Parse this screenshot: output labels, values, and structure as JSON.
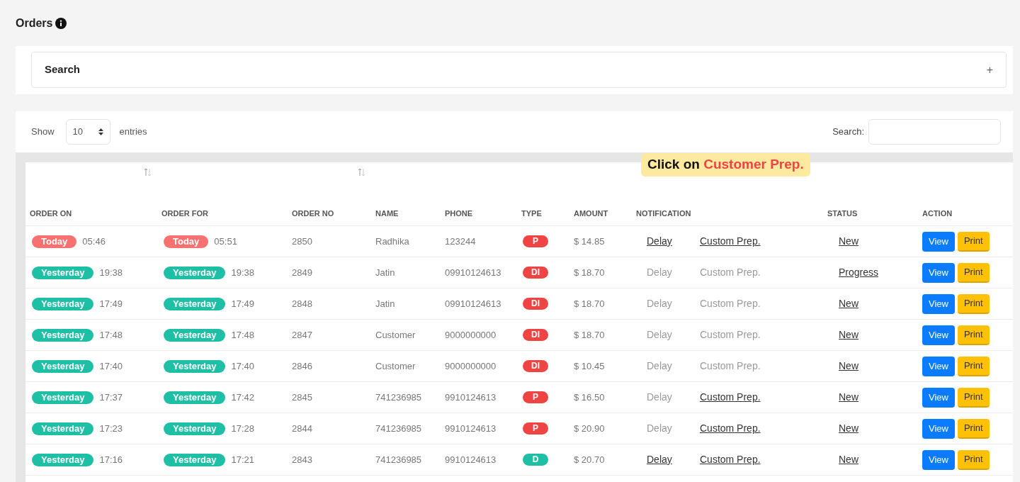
{
  "page": {
    "title": "Orders"
  },
  "search_panel": {
    "title": "Search",
    "toggle": "+"
  },
  "table_controls": {
    "show_label": "Show",
    "page_size": "10",
    "entries_label": "entries",
    "search_label": "Search:"
  },
  "callout": {
    "text": "Click on",
    "highlight": "Customer Prep."
  },
  "table": {
    "columns": [
      {
        "label": "ORDER ON",
        "sortable": true
      },
      {
        "label": "ORDER FOR",
        "sortable": false
      },
      {
        "label": "ORDER NO",
        "sortable": true
      },
      {
        "label": "NAME",
        "sortable": false
      },
      {
        "label": "PHONE",
        "sortable": false
      },
      {
        "label": "TYPE",
        "sortable": false
      },
      {
        "label": "AMOUNT",
        "sortable": false
      },
      {
        "label": "NOTIFICATION",
        "sortable": false
      },
      {
        "label": "STATUS",
        "sortable": false
      },
      {
        "label": "ACTION",
        "sortable": false
      }
    ],
    "rows": [
      {
        "order_on": {
          "day": "Today",
          "kind": "today",
          "time": "05:46"
        },
        "order_for": {
          "day": "Today",
          "kind": "today",
          "time": "05:51"
        },
        "order_no": "2850",
        "name": "Radhika",
        "phone": "123244",
        "type": {
          "label": "P",
          "color": "#ef4444"
        },
        "amount": "$ 14.85",
        "delay": {
          "label": "Delay",
          "disabled": false
        },
        "custom_prep": {
          "label": "Custom Prep.",
          "disabled": false
        },
        "status": "New",
        "view": "View",
        "print": "Print"
      },
      {
        "order_on": {
          "day": "Yesterday",
          "kind": "past",
          "time": "19:38"
        },
        "order_for": {
          "day": "Yesterday",
          "kind": "past",
          "time": "19:38"
        },
        "order_no": "2849",
        "name": "Jatin",
        "phone": "09910124613",
        "type": {
          "label": "DI",
          "color": "#ef4444"
        },
        "amount": "$ 18.70",
        "delay": {
          "label": "Delay",
          "disabled": true
        },
        "custom_prep": {
          "label": "Custom Prep.",
          "disabled": true
        },
        "status": "Progress",
        "view": "View",
        "print": "Print"
      },
      {
        "order_on": {
          "day": "Yesterday",
          "kind": "past",
          "time": "17:49"
        },
        "order_for": {
          "day": "Yesterday",
          "kind": "past",
          "time": "17:49"
        },
        "order_no": "2848",
        "name": "Jatin",
        "phone": "09910124613",
        "type": {
          "label": "DI",
          "color": "#ef4444"
        },
        "amount": "$ 18.70",
        "delay": {
          "label": "Delay",
          "disabled": true
        },
        "custom_prep": {
          "label": "Custom Prep.",
          "disabled": true
        },
        "status": "New",
        "view": "View",
        "print": "Print"
      },
      {
        "order_on": {
          "day": "Yesterday",
          "kind": "past",
          "time": "17:48"
        },
        "order_for": {
          "day": "Yesterday",
          "kind": "past",
          "time": "17:48"
        },
        "order_no": "2847",
        "name": "Customer",
        "phone": "9000000000",
        "type": {
          "label": "DI",
          "color": "#ef4444"
        },
        "amount": "$ 18.70",
        "delay": {
          "label": "Delay",
          "disabled": true
        },
        "custom_prep": {
          "label": "Custom Prep.",
          "disabled": true
        },
        "status": "New",
        "view": "View",
        "print": "Print"
      },
      {
        "order_on": {
          "day": "Yesterday",
          "kind": "past",
          "time": "17:40"
        },
        "order_for": {
          "day": "Yesterday",
          "kind": "past",
          "time": "17:40"
        },
        "order_no": "2846",
        "name": "Customer",
        "phone": "9000000000",
        "type": {
          "label": "DI",
          "color": "#ef4444"
        },
        "amount": "$ 10.45",
        "delay": {
          "label": "Delay",
          "disabled": true
        },
        "custom_prep": {
          "label": "Custom Prep.",
          "disabled": true
        },
        "status": "New",
        "view": "View",
        "print": "Print"
      },
      {
        "order_on": {
          "day": "Yesterday",
          "kind": "past",
          "time": "17:37"
        },
        "order_for": {
          "day": "Yesterday",
          "kind": "past",
          "time": "17:42"
        },
        "order_no": "2845",
        "name": "741236985",
        "phone": "9910124613",
        "type": {
          "label": "P",
          "color": "#ef4444"
        },
        "amount": "$ 16.50",
        "delay": {
          "label": "Delay",
          "disabled": true
        },
        "custom_prep": {
          "label": "Custom Prep.",
          "disabled": false
        },
        "status": "New",
        "view": "View",
        "print": "Print"
      },
      {
        "order_on": {
          "day": "Yesterday",
          "kind": "past",
          "time": "17:23"
        },
        "order_for": {
          "day": "Yesterday",
          "kind": "past",
          "time": "17:28"
        },
        "order_no": "2844",
        "name": "741236985",
        "phone": "9910124613",
        "type": {
          "label": "P",
          "color": "#ef4444"
        },
        "amount": "$ 20.90",
        "delay": {
          "label": "Delay",
          "disabled": true
        },
        "custom_prep": {
          "label": "Custom Prep.",
          "disabled": false
        },
        "status": "New",
        "view": "View",
        "print": "Print"
      },
      {
        "order_on": {
          "day": "Yesterday",
          "kind": "past",
          "time": "17:16"
        },
        "order_for": {
          "day": "Yesterday",
          "kind": "past",
          "time": "17:21"
        },
        "order_no": "2843",
        "name": "741236985",
        "phone": "9910124613",
        "type": {
          "label": "D",
          "color": "#1fbfa6"
        },
        "amount": "$ 20.70",
        "delay": {
          "label": "Delay",
          "disabled": false
        },
        "custom_prep": {
          "label": "Custom Prep.",
          "disabled": false
        },
        "status": "New",
        "view": "View",
        "print": "Print"
      }
    ]
  }
}
